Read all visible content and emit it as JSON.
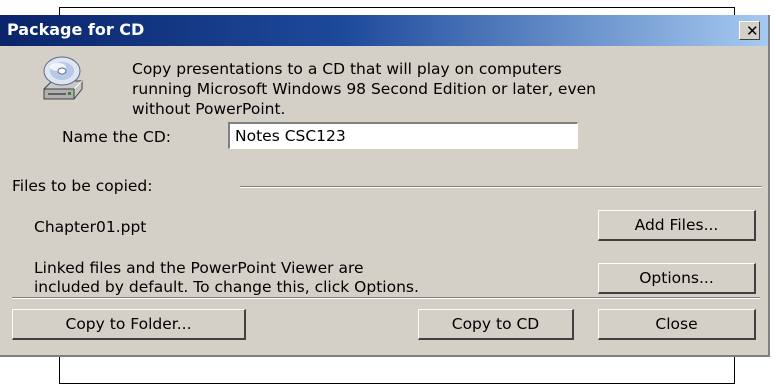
{
  "dialog": {
    "title": "Package for CD",
    "close_glyph": "✕",
    "description": "Copy presentations to a CD that will play on computers\nrunning Microsoft Windows 98 Second Edition or later, even\nwithout PowerPoint.",
    "name_label": "Name the CD:",
    "cd_name": "Notes CSC123",
    "files_group_label": "Files to be copied:",
    "files": [
      "Chapter01.ppt"
    ],
    "linked_note": "Linked files and the PowerPoint Viewer are\nincluded by default. To change this, click Options.",
    "buttons": {
      "add_files": "Add Files...",
      "options": "Options...",
      "copy_to_folder": "Copy to Folder...",
      "copy_to_cd": "Copy to CD",
      "close": "Close"
    },
    "icon": "cd-drive-icon"
  }
}
